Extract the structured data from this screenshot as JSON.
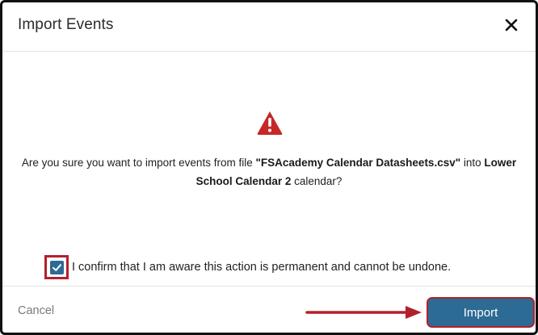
{
  "dialog": {
    "title": "Import Events",
    "close_icon": "close-icon"
  },
  "body": {
    "warning_icon": "warning-triangle-icon",
    "warning_color": "#c62828",
    "message": {
      "prefix": "Are you sure you want to import events from file ",
      "filename": "\"FSAcademy Calendar Datasheets.csv\"",
      "middle": " into ",
      "calendar_part1": "Lower",
      "calendar_part2": "School Calendar 2",
      "suffix": " calendar?"
    },
    "confirm": {
      "checked": true,
      "label": "I confirm that I am aware this action is permanent and cannot be undone."
    }
  },
  "footer": {
    "cancel_label": "Cancel",
    "import_label": "Import",
    "arrow_icon": "arrow-right-icon"
  },
  "colors": {
    "primary": "#2c6b94",
    "highlight": "#b3202a"
  }
}
